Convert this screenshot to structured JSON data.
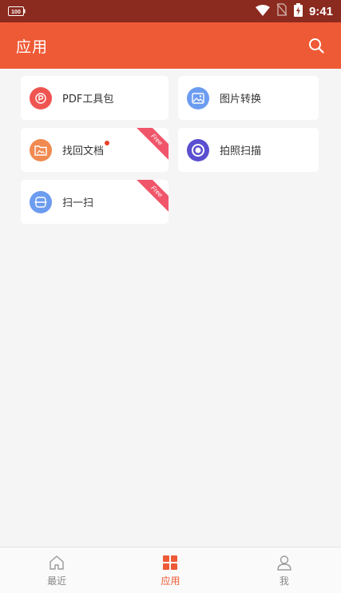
{
  "status_bar": {
    "time": "9:41",
    "battery_text": "100",
    "icons": [
      "battery-icon",
      "wifi-icon",
      "no-sim-icon",
      "charging-battery-icon"
    ]
  },
  "app_bar": {
    "title": "应用",
    "search_icon": "search-icon"
  },
  "apps": [
    {
      "label": "PDF工具包",
      "icon": "pdf-icon",
      "color": "#ef5450",
      "badge": "",
      "dot": false
    },
    {
      "label": "图片转换",
      "icon": "image-icon",
      "color": "#6c9cf0",
      "badge": "",
      "dot": false
    },
    {
      "label": "找回文档",
      "icon": "folder-image-icon",
      "color": "#f08a50",
      "badge": "Free",
      "dot": true
    },
    {
      "label": "拍照扫描",
      "icon": "camera-scan-icon",
      "color": "#5a4fd0",
      "badge": "",
      "dot": false
    },
    {
      "label": "扫一扫",
      "icon": "scan-icon",
      "color": "#6c9cf0",
      "badge": "Free",
      "dot": false
    }
  ],
  "bottom_nav": [
    {
      "label": "最近",
      "icon": "home-icon",
      "active": false
    },
    {
      "label": "应用",
      "icon": "grid-icon",
      "active": true
    },
    {
      "label": "我",
      "icon": "person-icon",
      "active": false
    }
  ],
  "colors": {
    "primary": "#ee5a36",
    "status_bar": "#8b2a1f",
    "ribbon": "#f0556a"
  }
}
